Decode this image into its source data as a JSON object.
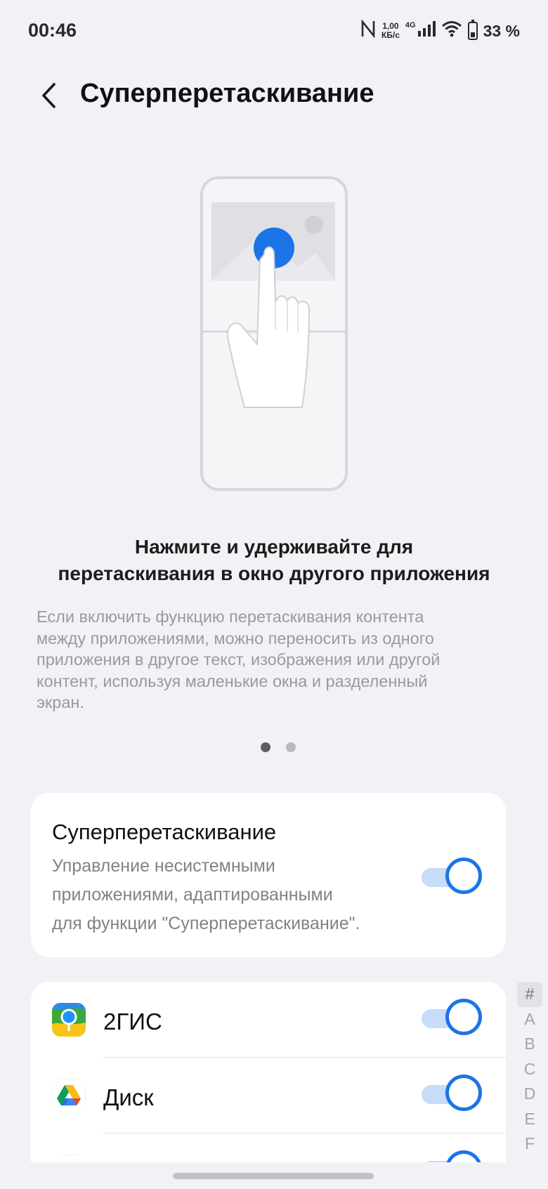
{
  "status_bar": {
    "time": "00:46",
    "nfc_icon": "nfc-icon",
    "speed_value": "1,00",
    "speed_unit": "КБ/с",
    "network": "4G",
    "battery": "33 %"
  },
  "header": {
    "title": "Суперперетаскивание",
    "back_icon": "chevron-left-icon"
  },
  "illustration": {
    "accent_color": "#1b74e8"
  },
  "intro": {
    "headline_line1": "Нажмите и удерживайте для",
    "headline_line2": "перетаскивания в окно другого приложения",
    "description_lines": [
      "Если включить функцию перетаскивания контента",
      "между приложениями, можно переносить из одного",
      "приложения в другое текст, изображения или другой",
      "контент, используя маленькие окна и разделенный",
      "экран."
    ]
  },
  "pager": {
    "total": 2,
    "active_index": 0
  },
  "main_setting": {
    "title": "Суперперетаскивание",
    "subtitle_lines": [
      "Управление несистемными",
      "приложениями, адаптированными",
      "для функции \"Суперперетаскивание\"."
    ],
    "enabled": true
  },
  "apps": [
    {
      "name": "2ГИС",
      "icon": "2gis-app-icon",
      "enabled": true
    },
    {
      "name": "Диск",
      "icon": "google-drive-icon",
      "enabled": true
    },
    {
      "name": "",
      "icon": "app-icon",
      "enabled": true
    }
  ],
  "index_bar": [
    "#",
    "A",
    "B",
    "C",
    "D",
    "E",
    "F"
  ],
  "colors": {
    "accent": "#1b74e8",
    "background": "#f2f2f6",
    "card": "#ffffff"
  }
}
